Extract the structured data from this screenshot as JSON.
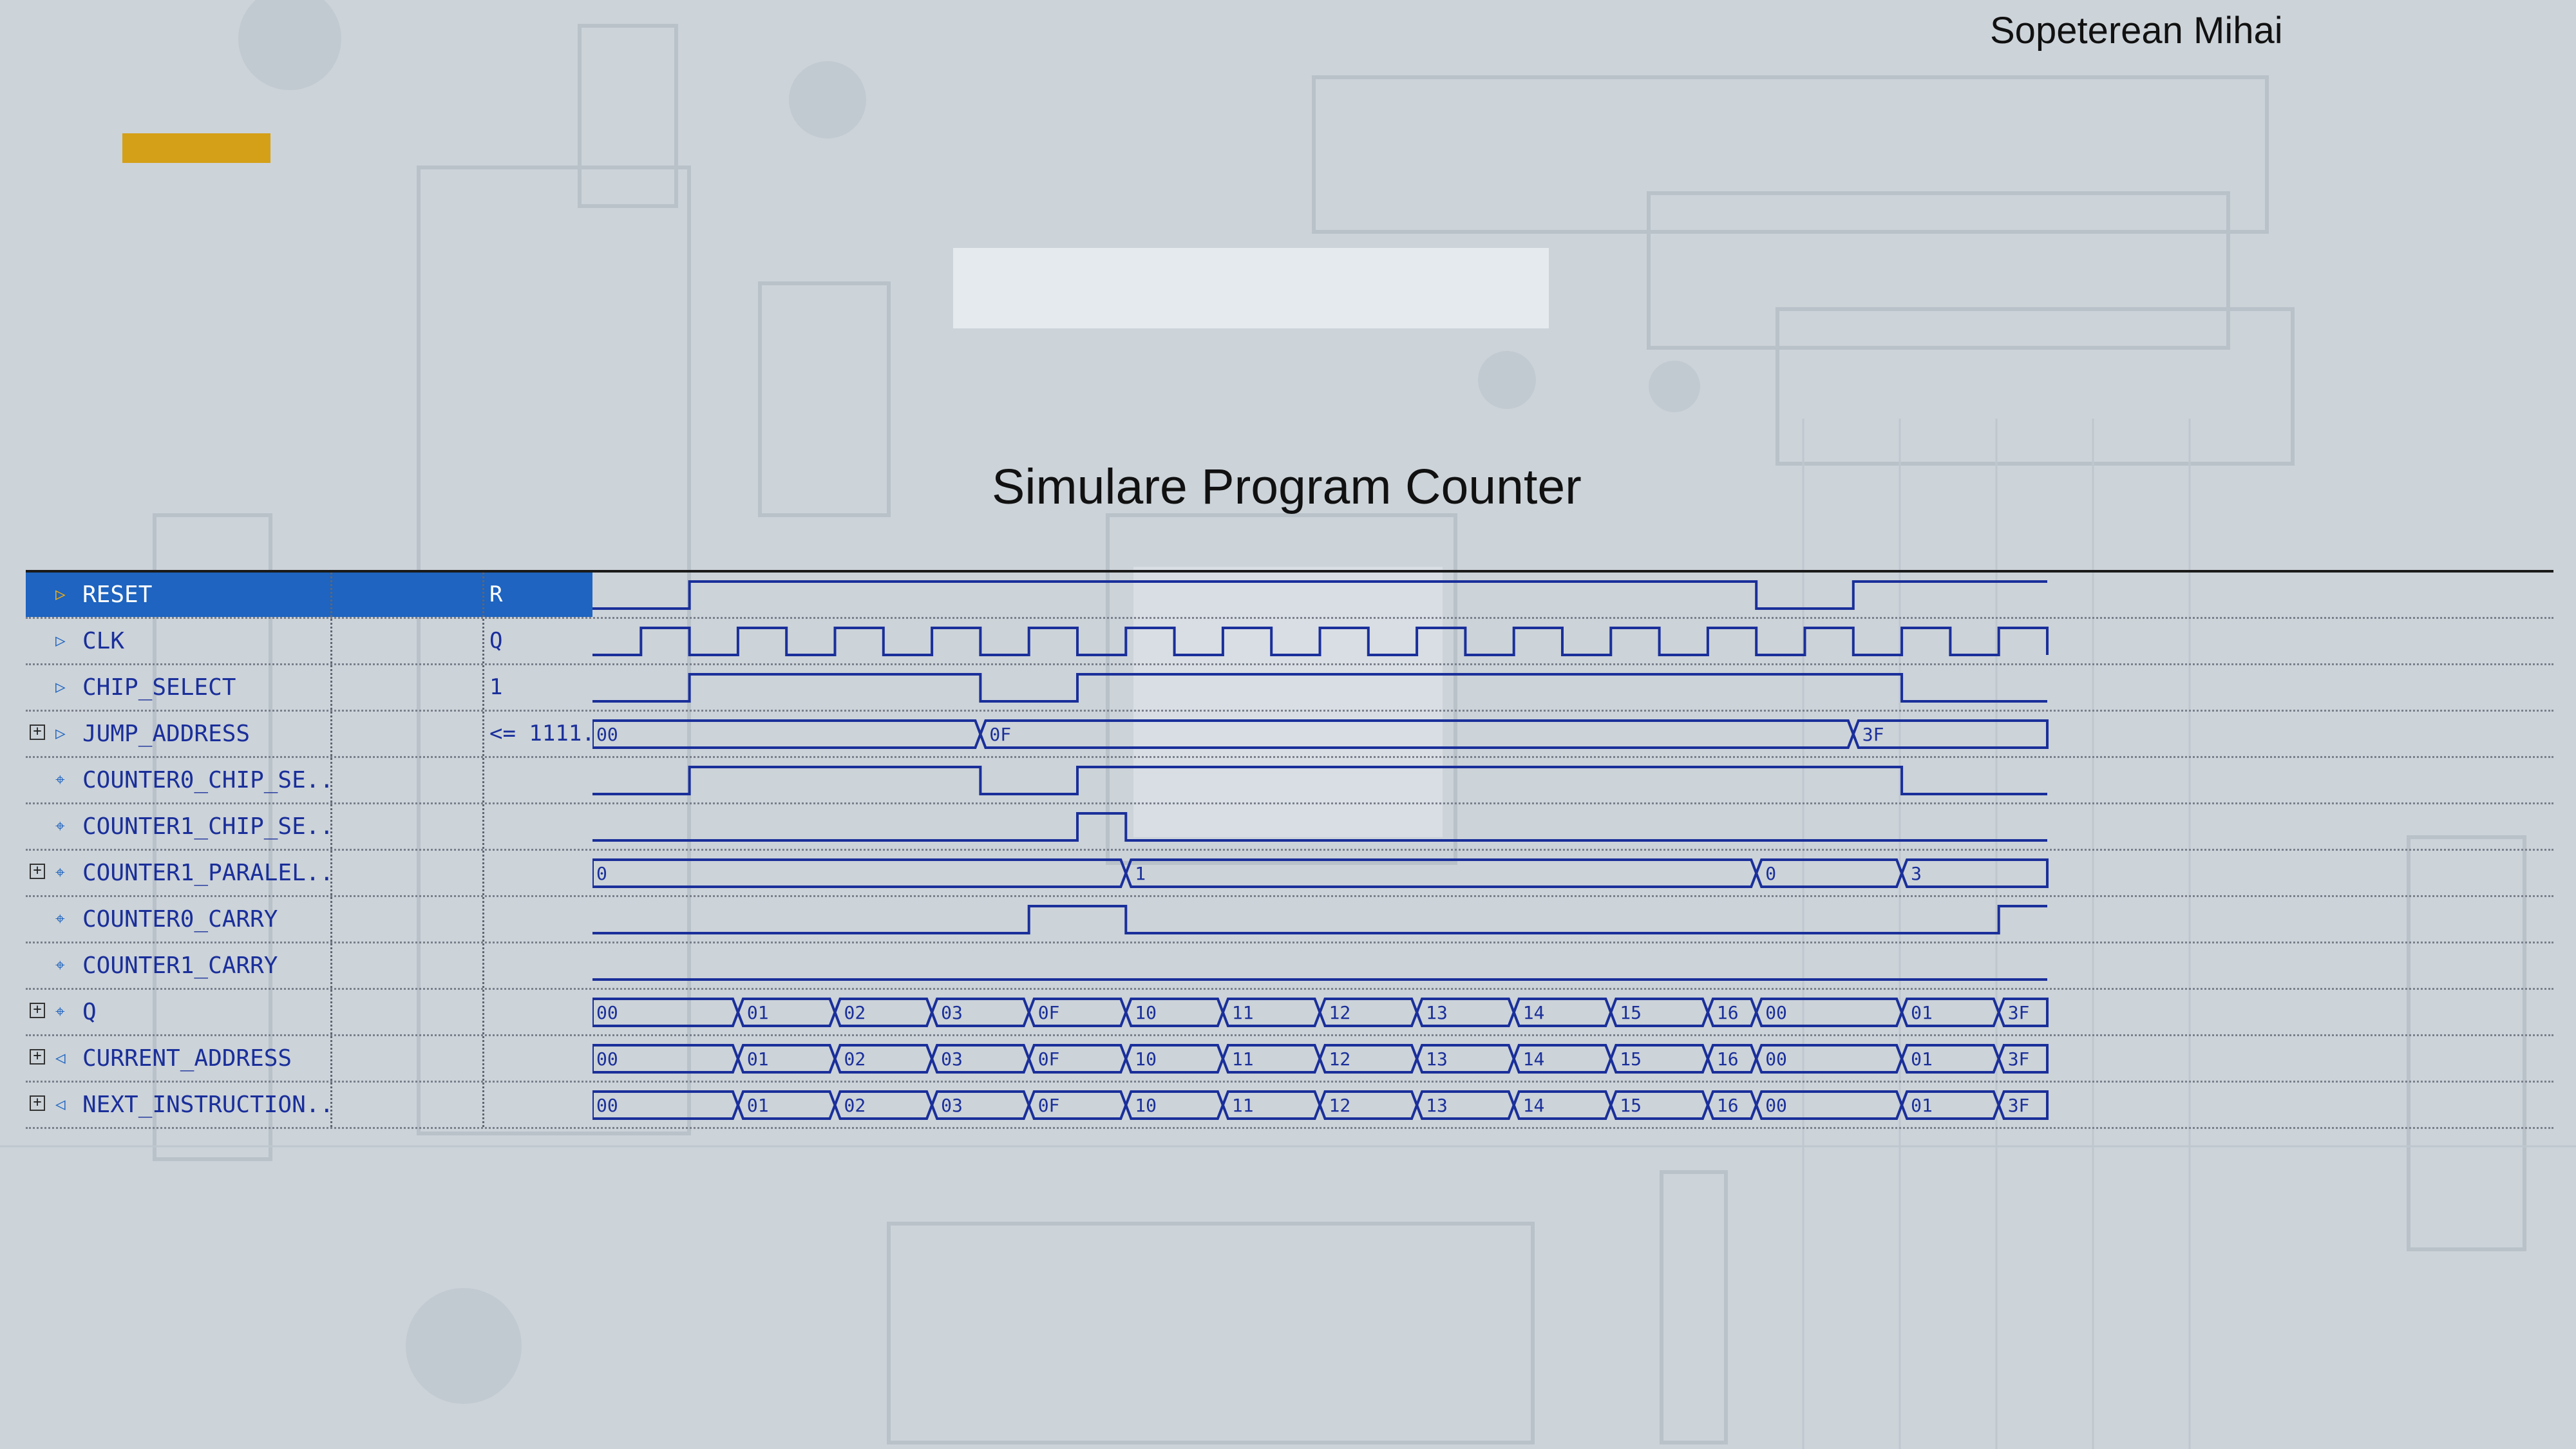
{
  "author": "Sopeterean Mihai",
  "title": "Simulare Program Counter",
  "colors": {
    "accent": "#d4a017",
    "wave": "#1a2f9a",
    "selected": "#1e64c0"
  },
  "timeline": {
    "t_end": 30
  },
  "signals": [
    {
      "name": "RESET",
      "value": "R",
      "icon": "input-port-icon",
      "expandable": false,
      "selected": true,
      "type": "bit",
      "init": 0,
      "edges": [
        2,
        24,
        26
      ]
    },
    {
      "name": "CLK",
      "value": "Q",
      "icon": "input-port-icon",
      "expandable": false,
      "type": "bit",
      "init": 0,
      "edges": [
        1,
        2,
        3,
        4,
        5,
        6,
        7,
        8,
        9,
        10,
        11,
        12,
        13,
        14,
        15,
        16,
        17,
        18,
        19,
        20,
        21,
        22,
        23,
        24,
        25,
        26,
        27,
        28,
        29,
        30
      ]
    },
    {
      "name": "CHIP_SELECT",
      "value": "1",
      "icon": "input-port-icon",
      "expandable": false,
      "type": "bit",
      "init": 0,
      "edges": [
        2,
        8,
        10,
        27
      ]
    },
    {
      "name": "JUMP_ADDRESS",
      "value": "<= 1111...",
      "icon": "input-port-icon",
      "expandable": true,
      "type": "bus",
      "segments": [
        [
          0,
          8,
          "00"
        ],
        [
          8,
          26,
          "0F"
        ],
        [
          26,
          30,
          "3F"
        ]
      ]
    },
    {
      "name": "COUNTER0_CHIP_SE...",
      "value": "",
      "icon": "internal-signal-icon",
      "expandable": false,
      "type": "bit",
      "init": 0,
      "edges": [
        2,
        8,
        10,
        27
      ]
    },
    {
      "name": "COUNTER1_CHIP_SE...",
      "value": "",
      "icon": "internal-signal-icon",
      "expandable": false,
      "type": "bit",
      "init": 0,
      "edges": [
        10,
        11
      ]
    },
    {
      "name": "COUNTER1_PARALEL...",
      "value": "",
      "icon": "internal-signal-icon",
      "expandable": true,
      "type": "bus",
      "segments": [
        [
          0,
          11,
          "0"
        ],
        [
          11,
          24,
          "1"
        ],
        [
          24,
          27,
          "0"
        ],
        [
          27,
          30,
          "3"
        ]
      ]
    },
    {
      "name": "COUNTER0_CARRY",
      "value": "",
      "icon": "internal-signal-icon",
      "expandable": false,
      "type": "bit",
      "init": 0,
      "edges": [
        9,
        11,
        29
      ]
    },
    {
      "name": "COUNTER1_CARRY",
      "value": "",
      "icon": "internal-signal-icon",
      "expandable": false,
      "type": "bit",
      "init": 0,
      "edges": []
    },
    {
      "name": "Q",
      "value": "",
      "icon": "internal-signal-icon",
      "expandable": true,
      "type": "bus",
      "segments": [
        [
          0,
          3,
          "00"
        ],
        [
          3,
          5,
          "01"
        ],
        [
          5,
          7,
          "02"
        ],
        [
          7,
          9,
          "03"
        ],
        [
          9,
          11,
          "0F"
        ],
        [
          11,
          13,
          "10"
        ],
        [
          13,
          15,
          "11"
        ],
        [
          15,
          17,
          "12"
        ],
        [
          17,
          19,
          "13"
        ],
        [
          19,
          21,
          "14"
        ],
        [
          21,
          23,
          "15"
        ],
        [
          23,
          24,
          "16"
        ],
        [
          24,
          27,
          "00"
        ],
        [
          27,
          29,
          "01"
        ],
        [
          29,
          30,
          "3F"
        ]
      ]
    },
    {
      "name": "CURRENT_ADDRESS",
      "value": "",
      "icon": "output-port-icon",
      "expandable": true,
      "type": "bus",
      "segments": [
        [
          0,
          3,
          "00"
        ],
        [
          3,
          5,
          "01"
        ],
        [
          5,
          7,
          "02"
        ],
        [
          7,
          9,
          "03"
        ],
        [
          9,
          11,
          "0F"
        ],
        [
          11,
          13,
          "10"
        ],
        [
          13,
          15,
          "11"
        ],
        [
          15,
          17,
          "12"
        ],
        [
          17,
          19,
          "13"
        ],
        [
          19,
          21,
          "14"
        ],
        [
          21,
          23,
          "15"
        ],
        [
          23,
          24,
          "16"
        ],
        [
          24,
          27,
          "00"
        ],
        [
          27,
          29,
          "01"
        ],
        [
          29,
          30,
          "3F"
        ]
      ]
    },
    {
      "name": "NEXT_INSTRUCTION...",
      "value": "",
      "icon": "output-port-icon",
      "expandable": true,
      "type": "bus",
      "segments": [
        [
          0,
          3,
          "00"
        ],
        [
          3,
          5,
          "01"
        ],
        [
          5,
          7,
          "02"
        ],
        [
          7,
          9,
          "03"
        ],
        [
          9,
          11,
          "0F"
        ],
        [
          11,
          13,
          "10"
        ],
        [
          13,
          15,
          "11"
        ],
        [
          15,
          17,
          "12"
        ],
        [
          17,
          19,
          "13"
        ],
        [
          19,
          21,
          "14"
        ],
        [
          21,
          23,
          "15"
        ],
        [
          23,
          24,
          "16"
        ],
        [
          24,
          27,
          "00"
        ],
        [
          27,
          29,
          "01"
        ],
        [
          29,
          30,
          "3F"
        ]
      ]
    }
  ]
}
